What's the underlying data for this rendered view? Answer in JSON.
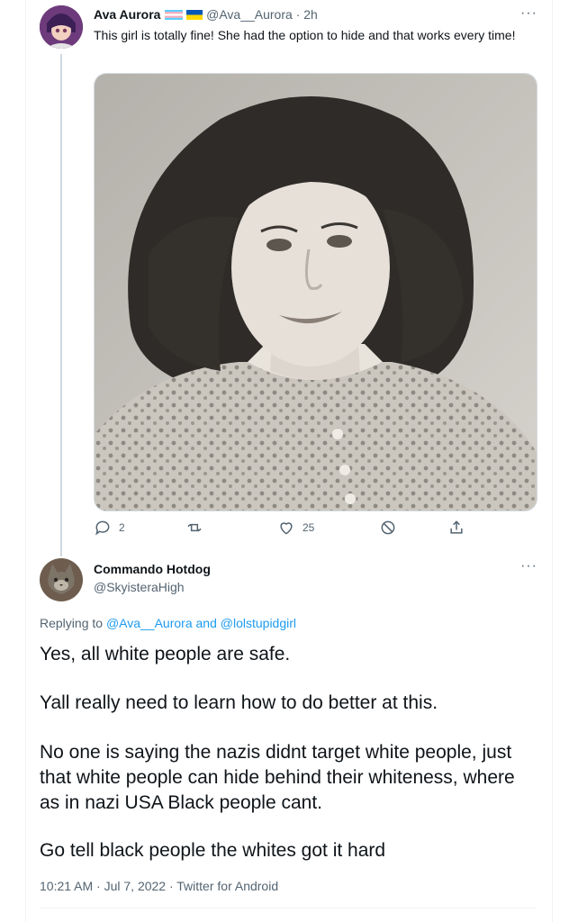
{
  "tweet": {
    "display_name": "Ava Aurora",
    "handle": "@Ava__Aurora",
    "separator": "·",
    "time": "2h",
    "text": "This girl is totally fine! She had the option to hide and that works every time!",
    "more_label": "···",
    "actions": {
      "replies": "2",
      "likes": "25"
    }
  },
  "reply": {
    "display_name": "Commando Hotdog",
    "handle": "@SkyisteraHigh",
    "more_label": "···",
    "replying_prefix": "Replying to",
    "replying_user1": "@Ava__Aurora",
    "replying_and": "and",
    "replying_user2": "@lolstupidgirl",
    "paragraphs": [
      "Yes, all white people are safe.",
      "Yall really need to learn how to do better at this.",
      "No one is saying the nazis didnt target white people, just that white people can hide behind their whiteness, where as in nazi USA Black people cant.",
      "Go tell black people the whites got it hard"
    ],
    "footer": "10:21 AM · Jul 7, 2022 · Twitter for Android"
  },
  "colors": {
    "accent": "#1d9bf0",
    "muted": "#536471",
    "text": "#0f1419"
  }
}
